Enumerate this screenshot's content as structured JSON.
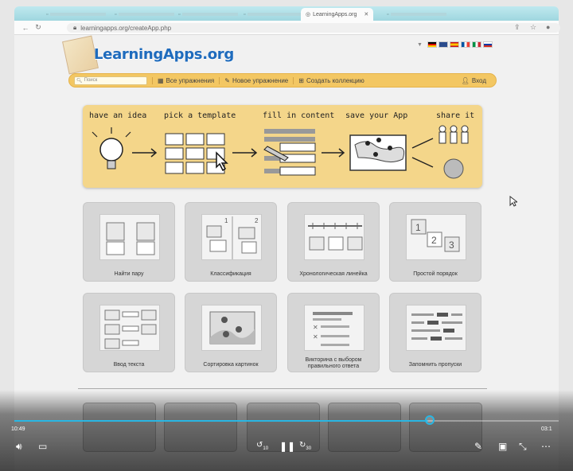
{
  "browser": {
    "tabs": [
      {
        "label": "LearningApps.org",
        "active": true
      }
    ],
    "url": "learningapps.org/createApp.php"
  },
  "site": {
    "logo": "LearningApps.org",
    "nav": {
      "search_placeholder": "Поиск",
      "all_exercises": "Все упражнения",
      "new_exercise": "Новое упражнение",
      "create_collection": "Создать коллекцию",
      "login": "Вход"
    },
    "banner_steps": [
      "have an idea",
      "pick a template",
      "fill in content",
      "save your App",
      "share it"
    ]
  },
  "templates": [
    {
      "label": "Найти пару",
      "icon": "pair-matching-icon"
    },
    {
      "label": "Классификация",
      "icon": "classification-icon"
    },
    {
      "label": "Хронологическая линейка",
      "icon": "timeline-icon"
    },
    {
      "label": "Простой порядок",
      "icon": "simple-order-icon"
    },
    {
      "label": "Ввод текста",
      "icon": "text-input-icon"
    },
    {
      "label": "Сортировка картинок",
      "icon": "picture-sorting-icon"
    },
    {
      "label": "Викторина с выбором правильного ответа",
      "icon": "quiz-icon"
    },
    {
      "label": "Запомнить пропуски",
      "icon": "fill-gaps-icon"
    }
  ],
  "player": {
    "elapsed": "10:49",
    "remaining": "03:1",
    "progress": 0.76,
    "skip_back": "10",
    "skip_forward": "30"
  },
  "colors": {
    "navbar": "#f3c763",
    "banner": "#f4d68a",
    "logo": "#1e6bbd",
    "progress": "#29b6e3"
  }
}
